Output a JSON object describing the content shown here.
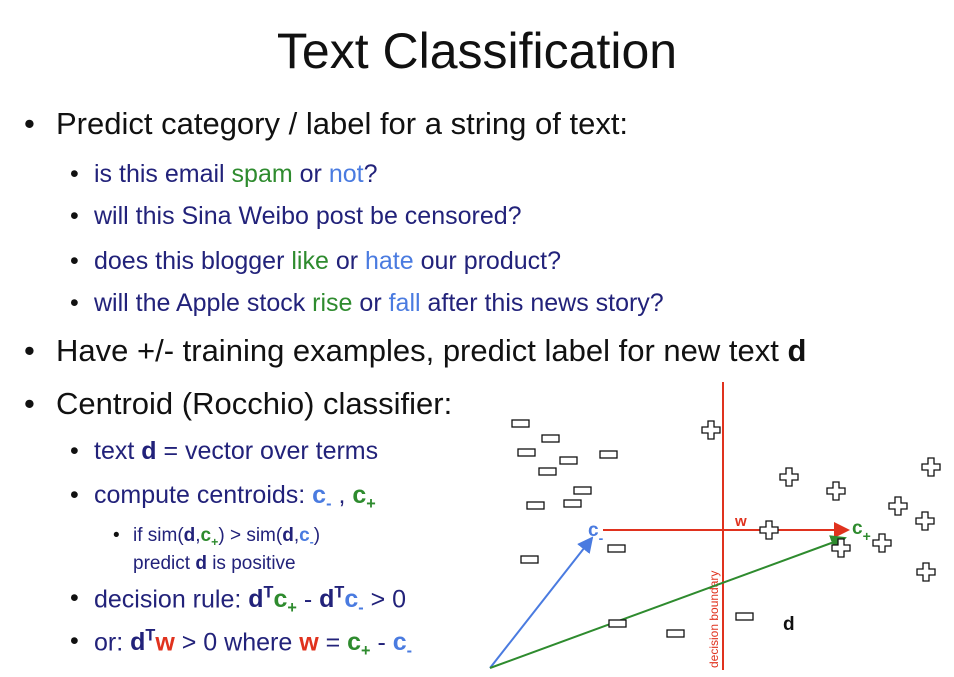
{
  "title": "Text Classification",
  "bullets": {
    "predict": "Predict category / label for a string of text:",
    "q1": {
      "a": "is this email ",
      "spam": "spam",
      "or": " or ",
      "not": "not",
      "end": "?"
    },
    "q2": "will this Sina Weibo post be censored?",
    "q3": {
      "a": "does this blogger ",
      "like": "like",
      "or": " or ",
      "hate": "hate",
      "end": " our product?"
    },
    "q4": {
      "a": "will the Apple stock ",
      "rise": "rise",
      "or": " or ",
      "fall": "fall",
      "end": " after this news story?"
    },
    "have": {
      "a": "Have +/- training examples, predict label for new text ",
      "d": "d"
    },
    "centroid": "Centroid (Rocchio) classifier:",
    "text_d": {
      "a": "text ",
      "d": "d",
      "b": " = vector over terms"
    },
    "compute": {
      "a": "compute centroids: ",
      "c": "c",
      "minus": "-",
      "sep": " , ",
      "plus": "+"
    },
    "ifsim": {
      "a": "if sim(",
      "d": "d",
      ",": ",",
      "c": "c",
      "plus": "+",
      "mid": ") > sim(",
      "minus": "-",
      "close": ")",
      "line2a": "predict ",
      "line2d": "d",
      "line2b": " is positive"
    },
    "rule": {
      "a": "decision rule: ",
      "d": "d",
      "T": "T",
      "c": "c",
      "plus": "+",
      "sep": " - ",
      "minus": "-",
      "end": " > 0"
    },
    "or": {
      "a": "or: ",
      "d": "d",
      "T": "T",
      "w": "w",
      "mid": " > 0 where ",
      "eq": " = ",
      "c": "c",
      "plus": "+",
      "sep": " - ",
      "minus": "-"
    }
  },
  "diagram": {
    "boundary_label": "decision boundary",
    "w_label": "w",
    "c_minus": "c",
    "c_minus_sub": "-",
    "c_plus": "c",
    "c_plus_sub": "+",
    "d_label": "d",
    "colors": {
      "red": "#e0321e",
      "blue": "#4a7be0",
      "green": "#2e8b2e"
    }
  }
}
